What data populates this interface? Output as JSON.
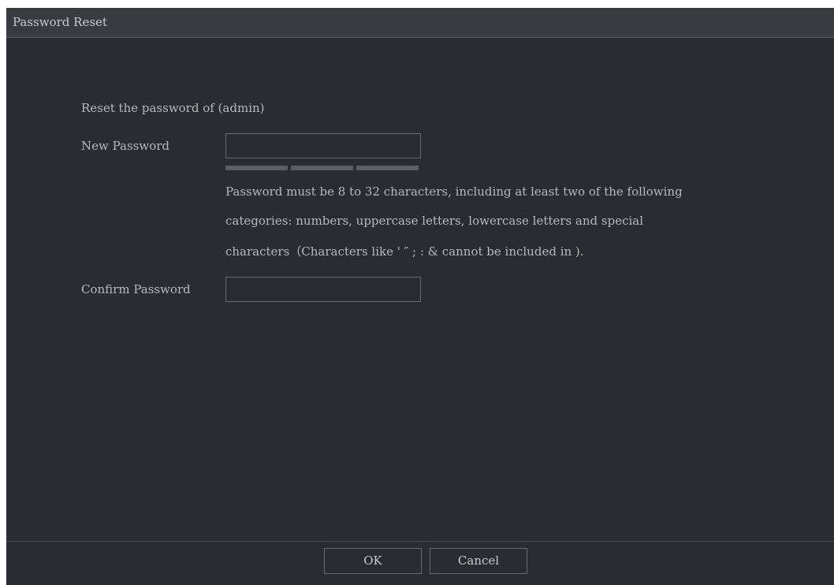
{
  "dialog": {
    "title": "Password Reset"
  },
  "form": {
    "reset_label": "Reset the password of (admin)",
    "new_password": {
      "label": "New Password",
      "value": ""
    },
    "strength_segments": 3,
    "hint_lines": [
      "Password must be 8 to 32 characters, including at least two of the following",
      "categories: numbers, uppercase letters, lowercase letters and special",
      "characters（Characters like ' ″ ; : & cannot be included in )."
    ],
    "confirm_password": {
      "label": "Confirm Password",
      "value": ""
    }
  },
  "buttons": {
    "ok_label": "OK",
    "cancel_label": "Cancel"
  },
  "colors": {
    "panel": "#2b2c32",
    "titlebar": "#3a3b41",
    "text": "#b8b8bc",
    "border": "#6a6b70",
    "strength_bar": "#5c5d62"
  }
}
